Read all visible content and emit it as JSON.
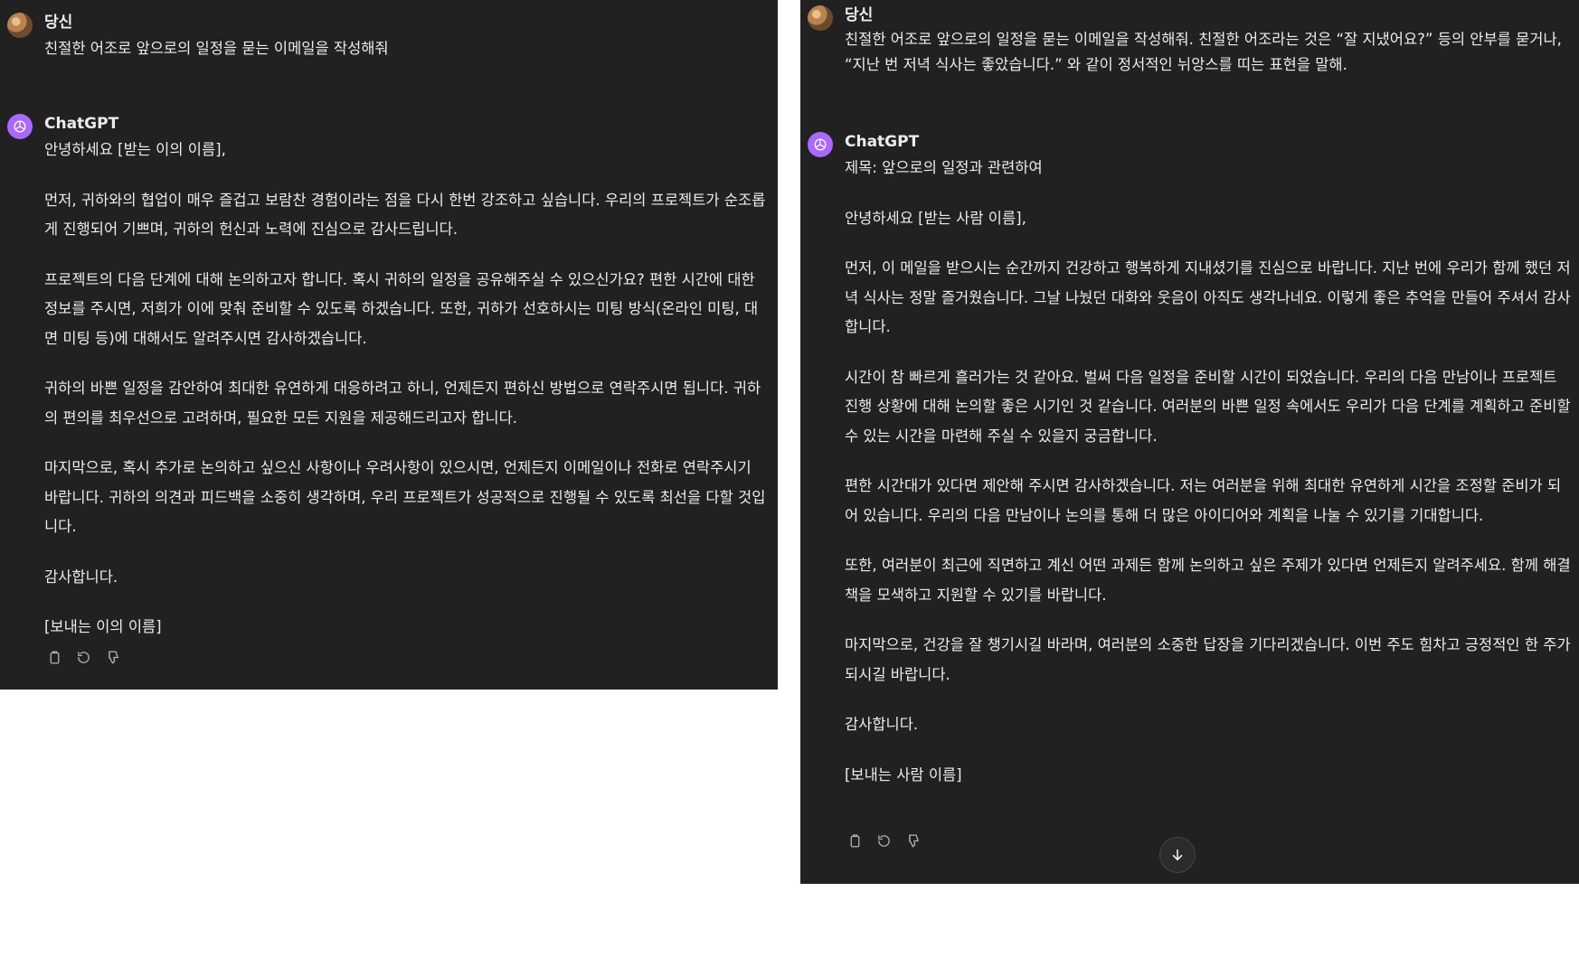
{
  "left": {
    "user_name": "당신",
    "user_message": "친절한 어조로 앞으로의 일정을 묻는 이메일을 작성해줘",
    "assistant_name": "ChatGPT",
    "paragraphs": [
      "안녕하세요 [받는 이의 이름],",
      "먼저, 귀하와의 협업이 매우 즐겁고 보람찬 경험이라는 점을 다시 한번 강조하고 싶습니다. 우리의 프로젝트가 순조롭게 진행되어 기쁘며, 귀하의 헌신과 노력에 진심으로 감사드립니다.",
      "프로젝트의 다음 단계에 대해 논의하고자 합니다. 혹시 귀하의 일정을 공유해주실 수 있으신가요? 편한 시간에 대한 정보를 주시면, 저희가 이에 맞춰 준비할 수 있도록 하겠습니다. 또한, 귀하가 선호하시는 미팅 방식(온라인 미팅, 대면 미팅 등)에 대해서도 알려주시면 감사하겠습니다.",
      "귀하의 바쁜 일정을 감안하여 최대한 유연하게 대응하려고 하니, 언제든지 편하신 방법으로 연락주시면 됩니다. 귀하의 편의를 최우선으로 고려하며, 필요한 모든 지원을 제공해드리고자 합니다.",
      "마지막으로, 혹시 추가로 논의하고 싶으신 사항이나 우려사항이 있으시면, 언제든지 이메일이나 전화로 연락주시기 바랍니다. 귀하의 의견과 피드백을 소중히 생각하며, 우리 프로젝트가 성공적으로 진행될 수 있도록 최선을 다할 것입니다.",
      "감사합니다.",
      "[보내는 이의 이름]"
    ]
  },
  "right": {
    "user_name": "당신",
    "user_message": "친절한 어조로 앞으로의 일정을 묻는 이메일을 작성해줘. 친절한 어조라는 것은 “잘 지냈어요?” 등의 안부를 묻거나, “지난 번 저녁 식사는 좋았습니다.” 와 같이 정서적인 뉘앙스를 띠는 표현을 말해.",
    "assistant_name": "ChatGPT",
    "paragraphs": [
      "제목: 앞으로의 일정과 관련하여",
      "안녕하세요 [받는 사람 이름],",
      "먼저, 이 메일을 받으시는 순간까지 건강하고 행복하게 지내셨기를 진심으로 바랍니다. 지난 번에 우리가 함께 했던 저녁 식사는 정말 즐거웠습니다. 그날 나눴던 대화와 웃음이 아직도 생각나네요. 이렇게 좋은 추억을 만들어 주셔서 감사합니다.",
      "시간이 참 빠르게 흘러가는 것 같아요. 벌써 다음 일정을 준비할 시간이 되었습니다. 우리의 다음 만남이나 프로젝트 진행 상황에 대해 논의할 좋은 시기인 것 같습니다. 여러분의 바쁜 일정 속에서도 우리가 다음 단계를 계획하고 준비할 수 있는 시간을 마련해 주실 수 있을지 궁금합니다.",
      "편한 시간대가 있다면 제안해 주시면 감사하겠습니다. 저는 여러분을 위해 최대한 유연하게 시간을 조정할 준비가 되어 있습니다. 우리의 다음 만남이나 논의를 통해 더 많은 아이디어와 계획을 나눌 수 있기를 기대합니다.",
      "또한, 여러분이 최근에 직면하고 계신 어떤 과제든 함께 논의하고 싶은 주제가 있다면 언제든지 알려주세요. 함께 해결책을 모색하고 지원할 수 있기를 바랍니다.",
      "마지막으로, 건강을 잘 챙기시길 바라며, 여러분의 소중한 답장을 기다리겠습니다. 이번 주도 힘차고 긍정적인 한 주가 되시길 바랍니다.",
      "감사합니다.",
      "[보내는 사람 이름]"
    ]
  },
  "icons": {
    "copy": "copy-icon",
    "regenerate": "regenerate-icon",
    "dislike": "thumbs-down-icon",
    "scroll": "arrow-down-icon"
  },
  "colors": {
    "panel_bg": "#212121",
    "text": "#ececec",
    "gpt_avatar": "#ab68ff"
  }
}
